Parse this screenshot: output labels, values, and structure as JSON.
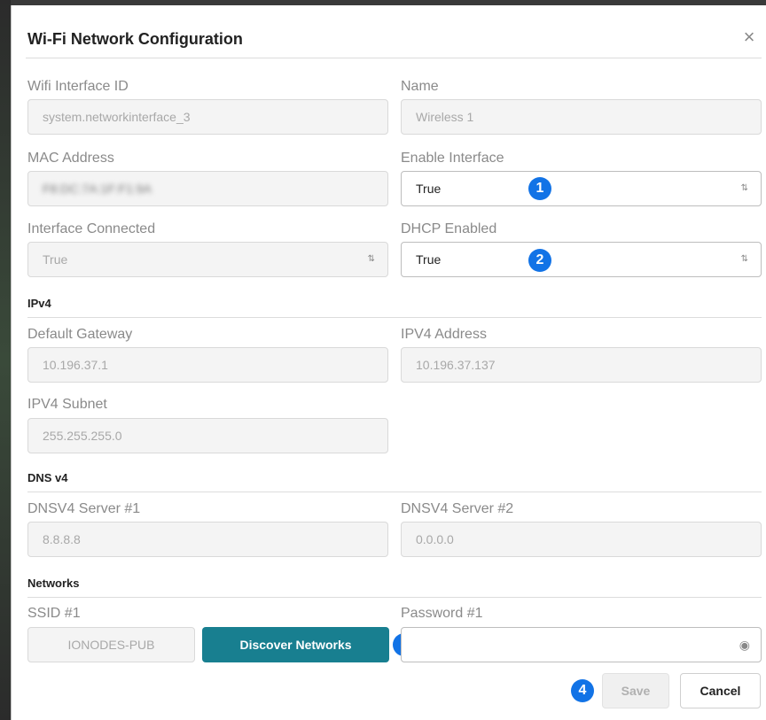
{
  "dialog": {
    "title": "Wi-Fi Network Configuration",
    "close_glyph": "×"
  },
  "fields": {
    "wifi_interface_id": {
      "label": "Wifi Interface ID",
      "value": "system.networkinterface_3"
    },
    "name": {
      "label": "Name",
      "value": "Wireless 1"
    },
    "mac_address": {
      "label": "MAC Address",
      "value": "F8:DC:7A:1F:F1:9A"
    },
    "enable_interface": {
      "label": "Enable Interface",
      "value": "True"
    },
    "interface_connected": {
      "label": "Interface Connected",
      "value": "True"
    },
    "dhcp_enabled": {
      "label": "DHCP Enabled",
      "value": "True"
    }
  },
  "ipv4": {
    "section_title": "IPv4",
    "default_gateway": {
      "label": "Default Gateway",
      "value": "10.196.37.1"
    },
    "ipv4_address": {
      "label": "IPV4 Address",
      "value": "10.196.37.137"
    },
    "ipv4_subnet": {
      "label": "IPV4 Subnet",
      "value": "255.255.255.0"
    }
  },
  "dns": {
    "section_title": "DNS v4",
    "server1": {
      "label": "DNSV4 Server #1",
      "value": "8.8.8.8"
    },
    "server2": {
      "label": "DNSV4 Server #2",
      "value": "0.0.0.0"
    }
  },
  "networks": {
    "section_title": "Networks",
    "ssid1": {
      "label": "SSID #1",
      "value": "IONODES-PUB"
    },
    "discover_button": "Discover Networks",
    "password1": {
      "label": "Password #1",
      "value": ""
    }
  },
  "footer": {
    "save_label": "Save",
    "cancel_label": "Cancel"
  },
  "badges": [
    "1",
    "2",
    "3",
    "4"
  ],
  "colors": {
    "accent_teal": "#187f90",
    "badge_blue": "#1273e6"
  },
  "icons": {
    "close": "close-icon",
    "select_chevron": "chevron-updown-icon",
    "password_toggle": "eye-icon"
  }
}
